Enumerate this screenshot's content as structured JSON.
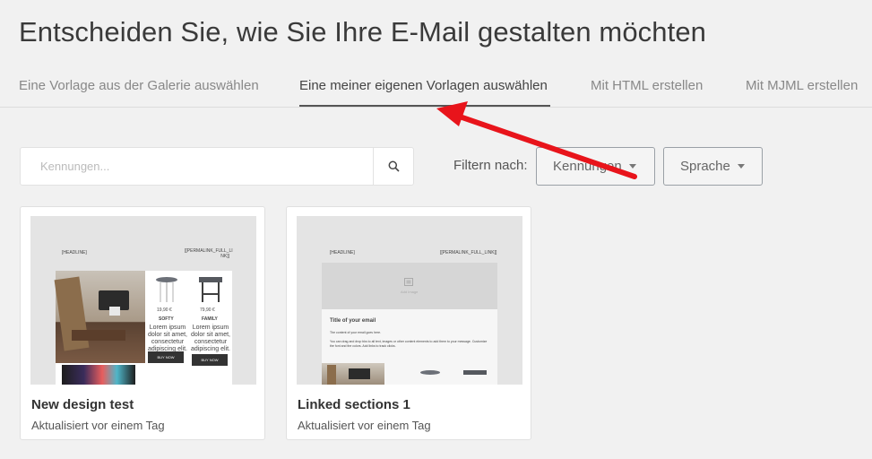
{
  "page": {
    "title": "Entscheiden Sie, wie Sie Ihre E-Mail gestalten möchten"
  },
  "tabs": [
    {
      "label": "Eine Vorlage aus der Galerie auswählen",
      "active": false
    },
    {
      "label": "Eine meiner eigenen Vorlagen auswählen",
      "active": true
    },
    {
      "label": "Mit HTML erstellen",
      "active": false
    },
    {
      "label": "Mit MJML erstellen",
      "active": false
    }
  ],
  "search": {
    "placeholder": "Kennungen...",
    "value": "",
    "icon": "search-icon"
  },
  "filter": {
    "label": "Filtern nach:",
    "dropdowns": [
      {
        "label": "Kennungen",
        "icon": "caret-down-icon"
      },
      {
        "label": "Sprache",
        "icon": "caret-down-icon"
      }
    ]
  },
  "templates": [
    {
      "title": "New design test",
      "updated": "Aktualisiert vor einem Tag",
      "preview": {
        "headline": "[HEADLINE]",
        "permalink": "[[PERMALINK_FULL_LI NK]]",
        "products": [
          {
            "price": "19,90 €",
            "name": "SOFTY",
            "text": "Lorem ipsum dolor sit amet, consectetur adipiscing elit.",
            "button": "BUY NOW"
          },
          {
            "price": "79,90 €",
            "name": "FAMILY",
            "text": "Lorem ipsum dolor sit amet, consectetur adipiscing elit.",
            "button": "BUY NOW"
          }
        ]
      }
    },
    {
      "title": "Linked sections 1",
      "updated": "Aktualisiert vor einem Tag",
      "preview": {
        "headline": "[HEADLINE]",
        "permalink": "[[PERMALINK_FULL_LINK]]",
        "image_label": "Add Image",
        "email_title": "Title of your email",
        "line1": "The content of your email goes here.",
        "line2": "You can drag and drop bks to all text, images or other content elements to add them to your message. Customize the font and the colors. Add links to track clicks."
      }
    }
  ],
  "annotation": {
    "color": "#e8141b"
  },
  "colors": {
    "background": "#f1f1f1",
    "card": "#ffffff",
    "accent_arrow": "#e8141b"
  }
}
